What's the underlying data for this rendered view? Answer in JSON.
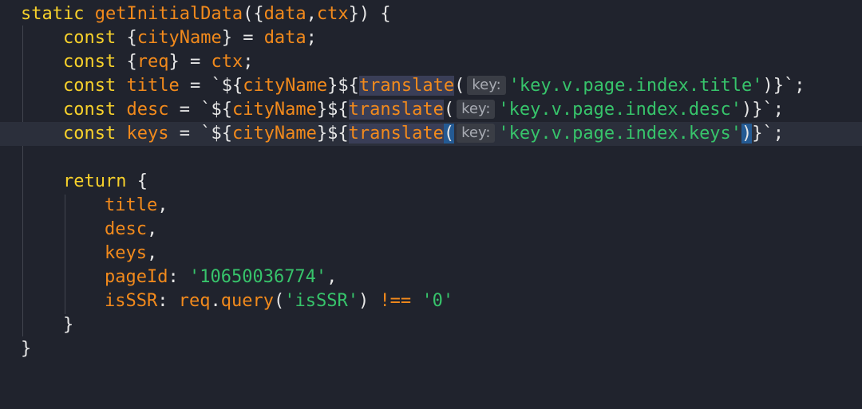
{
  "code": {
    "line1": {
      "kw": "static",
      "fn": "getInitialData",
      "open": "({",
      "p1": "data",
      "comma": ",",
      "p2": "ctx",
      "close": "}) {"
    },
    "line2": {
      "kw": "const",
      "open": " {",
      "v": "cityName",
      "close": "} = ",
      "src": "data",
      "semi": ";"
    },
    "line3": {
      "kw": "const",
      "open": " {",
      "v": "req",
      "close": "} = ",
      "src": "ctx",
      "semi": ";"
    },
    "line4": {
      "kw": "const",
      "v": "title",
      "eq": " = `${",
      "tmpl": "cityName",
      "mid": "}${",
      "fn": "translate",
      "paren": "(",
      "hint": "key:",
      "str": "'key.v.page.index.title'",
      "end": ")}`;"
    },
    "line5": {
      "kw": "const",
      "v": "desc",
      "eq": " = `${",
      "tmpl": "cityName",
      "mid": "}${",
      "fn": "translate",
      "paren": "(",
      "hint": "key:",
      "str": "'key.v.page.index.desc'",
      "end": ")}`;"
    },
    "line6": {
      "kw": "const",
      "v": "keys",
      "eq": " = `${",
      "tmpl": "cityName",
      "mid": "}${",
      "fn": "translate",
      "paren_open": "(",
      "hint": "key:",
      "str": "'key.v.page.index.keys'",
      "paren_close": ")",
      "end": "}`;"
    },
    "line8": {
      "kw": "return",
      "brace": " {"
    },
    "line9": {
      "prop": "title",
      "comma": ","
    },
    "line10": {
      "prop": "desc",
      "comma": ","
    },
    "line11": {
      "prop": "keys",
      "comma": ","
    },
    "line12": {
      "prop": "pageId",
      "colon": ": ",
      "str": "'10650036774'",
      "comma": ","
    },
    "line13": {
      "prop": "isSSR",
      "colon": ": ",
      "obj": "req",
      "dot": ".",
      "method": "query",
      "open": "(",
      "str": "'isSSR'",
      "close": ") ",
      "op": "!==",
      "sp": " ",
      "str2": "'0'"
    },
    "line14": {
      "brace": "}"
    },
    "line15": {
      "brace": "}"
    }
  }
}
